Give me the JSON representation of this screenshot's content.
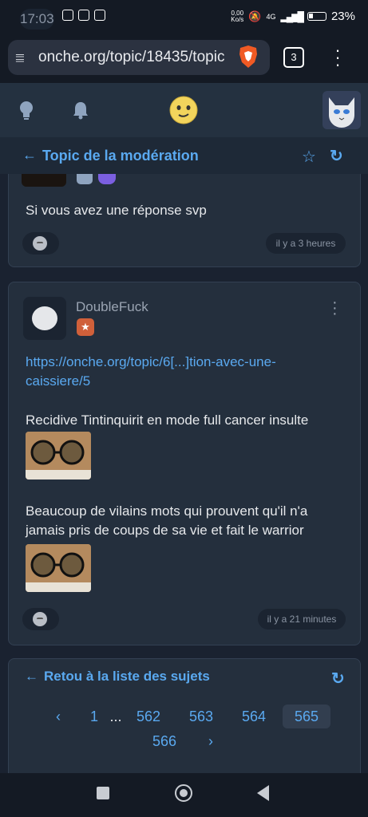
{
  "status_bar": {
    "time": "17:03",
    "net_speed_top": "0,00",
    "net_speed_bottom": "Ko/s",
    "network": "4G",
    "battery": "23%"
  },
  "browser": {
    "url": "onche.org/topic/18435/topic",
    "tab_count": "3"
  },
  "topic": {
    "title": "Topic de la modération"
  },
  "posts": [
    {
      "text": "Si vous avez une réponse svp",
      "time": "il y a 3 heures"
    },
    {
      "author": "DoubleFuck",
      "link": "https://onche.org/topic/6[...]tion-avec-une-caissiere/5",
      "paragraph1": "Recidive Tintinquirit en mode full cancer insulte",
      "paragraph2": "Beaucoup de vilains mots qui prouvent qu'il n'a jamais pris de coups de sa vie et fait le warrior",
      "time": "il y a 21 minutes"
    }
  ],
  "pagination": {
    "back_label": "Retou à la liste des sujets",
    "prev": "‹",
    "next": "›",
    "pages": [
      "1",
      "...",
      "562",
      "563",
      "564",
      "565",
      "566"
    ],
    "current": "565"
  },
  "colors": {
    "accent": "#5aa9f0",
    "background": "#1a2230",
    "card": "#242f3d",
    "header": "#243140"
  }
}
